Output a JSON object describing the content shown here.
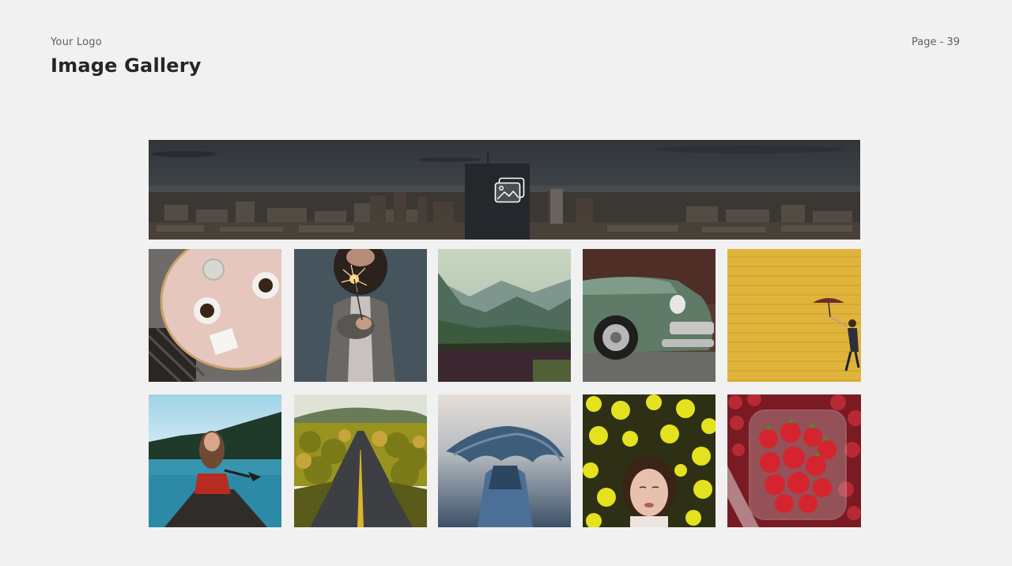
{
  "header": {
    "logo_text": "Your Logo",
    "title": "Image Gallery",
    "page_label": "Page  -  39"
  },
  "banner": {
    "icon": "image-gallery-icon"
  },
  "gallery": {
    "row1": [
      {
        "name": "photo-cafe-table",
        "subject": "coffee cups on marble table"
      },
      {
        "name": "photo-sparkler",
        "subject": "person holding sparkler"
      },
      {
        "name": "photo-mountains",
        "subject": "green mountain valley"
      },
      {
        "name": "photo-vintage-car",
        "subject": "old green car"
      },
      {
        "name": "photo-yellow-wall",
        "subject": "woman with umbrella on yellow wall"
      }
    ],
    "row2": [
      {
        "name": "photo-canoe-lake",
        "subject": "woman in canoe on lake"
      },
      {
        "name": "photo-road",
        "subject": "road through forest"
      },
      {
        "name": "photo-hair-flip",
        "subject": "woman flipping blue hair"
      },
      {
        "name": "photo-yellow-flowers",
        "subject": "woman among yellow flowers"
      },
      {
        "name": "photo-strawberries",
        "subject": "strawberries in container"
      }
    ]
  },
  "colors": {
    "background": "#f1f1f1",
    "title": "#262626",
    "muted_text": "#5f5f5f"
  }
}
